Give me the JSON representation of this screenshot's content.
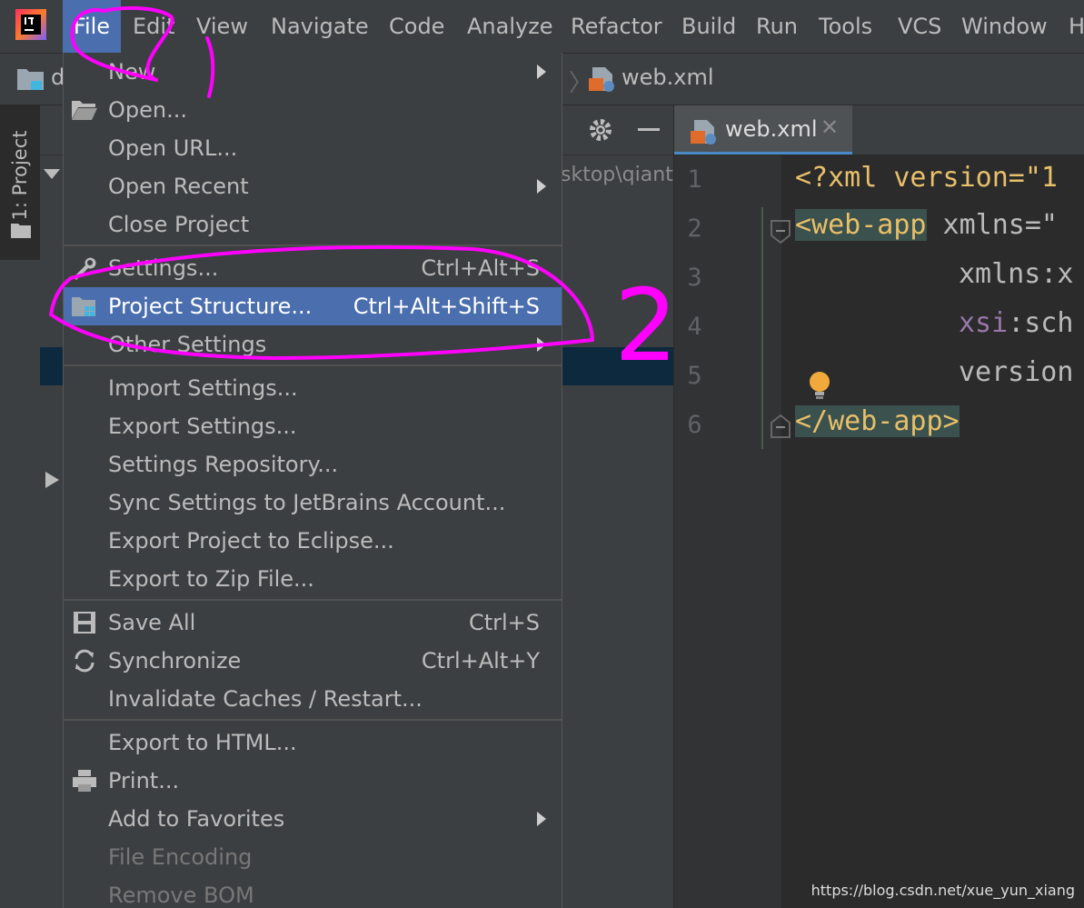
{
  "menubar": {
    "items": [
      "File",
      "Edit",
      "View",
      "Navigate",
      "Code",
      "Analyze",
      "Refactor",
      "Build",
      "Run",
      "Tools",
      "VCS",
      "Window",
      "H"
    ]
  },
  "navbar": {
    "project_label": "d",
    "file_label": "web.xml"
  },
  "toolwindow": {
    "project_tab": "1: Project"
  },
  "project_panel": {
    "path_fragment": "sktop\\qiant"
  },
  "editor": {
    "tab_label": "web.xml",
    "line_numbers": [
      "1",
      "2",
      "3",
      "4",
      "5",
      "6"
    ],
    "lines": {
      "l1": "<?xml version=\"1",
      "l2_tag": "<web-app",
      "l2_attr": " xmlns=\"",
      "l3": "xmlns:x",
      "l4_ns": "xsi",
      "l4_rest": ":sch",
      "l5": "version",
      "l6_tag": "</web-app>"
    }
  },
  "file_menu": {
    "new": "New",
    "open": "Open...",
    "open_url": "Open URL...",
    "open_recent": "Open Recent",
    "close_project": "Close Project",
    "settings": "Settings...",
    "settings_shortcut": "Ctrl+Alt+S",
    "project_structure": "Project Structure...",
    "project_structure_shortcut": "Ctrl+Alt+Shift+S",
    "other_settings": "Other Settings",
    "import_settings": "Import Settings...",
    "export_settings": "Export Settings...",
    "settings_repository": "Settings Repository...",
    "sync_settings": "Sync Settings to JetBrains Account...",
    "export_eclipse": "Export Project to Eclipse...",
    "export_zip": "Export to Zip File...",
    "save_all": "Save All",
    "save_all_shortcut": "Ctrl+S",
    "synchronize": "Synchronize",
    "synchronize_shortcut": "Ctrl+Alt+Y",
    "invalidate_caches": "Invalidate Caches / Restart...",
    "export_html": "Export to HTML...",
    "print": "Print...",
    "add_favorites": "Add to Favorites",
    "file_encoding": "File Encoding",
    "remove_bom": "Remove BOM"
  },
  "annotations": {
    "step_two": "2"
  },
  "watermark": "https://blog.csdn.net/xue_yun_xiang",
  "colors": {
    "accent": "#4b6eaf",
    "highlight_pen": "#ff00ff",
    "xml_tag": "#e8bf6a"
  }
}
